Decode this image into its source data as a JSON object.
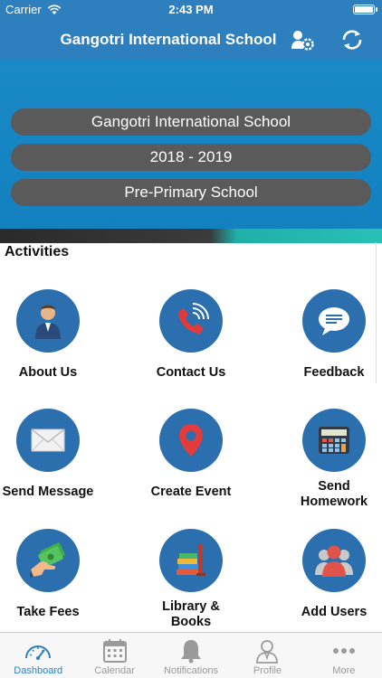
{
  "status_bar": {
    "carrier": "Carrier",
    "time": "2:43 PM"
  },
  "nav": {
    "title": "Gangotri International School"
  },
  "banner": {
    "school": "Gangotri International School",
    "year": "2018 - 2019",
    "section": "Pre-Primary School"
  },
  "activities": {
    "title": "Activities",
    "items": [
      {
        "label": "About Us",
        "icon": "person-icon"
      },
      {
        "label": "Contact Us",
        "icon": "phone-icon"
      },
      {
        "label": "Feedback",
        "icon": "chat-bubble-icon"
      },
      {
        "label": "Send Message",
        "icon": "envelope-icon"
      },
      {
        "label": "Create Event",
        "icon": "map-pin-icon"
      },
      {
        "label": "Send Homework",
        "icon": "calculator-icon"
      },
      {
        "label": "Take Fees",
        "icon": "cash-hand-icon"
      },
      {
        "label": "Library & Books",
        "icon": "books-icon"
      },
      {
        "label": "Add Users",
        "icon": "users-icon"
      }
    ]
  },
  "tabs": [
    {
      "label": "Dashboard",
      "icon": "speedometer-icon",
      "active": true
    },
    {
      "label": "Calendar",
      "icon": "calendar-icon",
      "active": false
    },
    {
      "label": "Notifications",
      "icon": "bell-icon",
      "active": false
    },
    {
      "label": "Profile",
      "icon": "profile-icon",
      "active": false
    },
    {
      "label": "More",
      "icon": "more-icon",
      "active": false
    }
  ],
  "colors": {
    "primary": "#2d7fbd",
    "banner": "#1584c2",
    "pill": "#5a5a5a",
    "tile_circle": "#2c6fae"
  }
}
